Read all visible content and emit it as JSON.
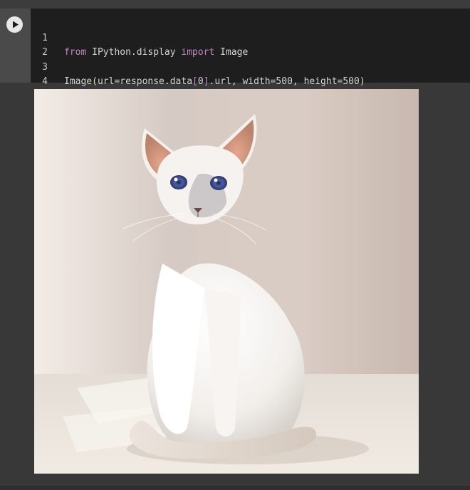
{
  "cell": {
    "run_icon": "play-icon",
    "lines": [
      {
        "num": "1",
        "kw1": "from",
        "mod": " IPython.display ",
        "kw2": "import",
        "name": " Image"
      },
      {
        "num": "2"
      },
      {
        "num": "3",
        "p1": "Image",
        "p2": "(",
        "p3": "url=response.data",
        "p4": "[",
        "p5": "0",
        "p6": "]",
        "p7": ".url, width=500, height=500",
        "p8": ")"
      },
      {
        "num": "4"
      }
    ]
  },
  "output": {
    "image_subject": "white siamese cat sitting on floor"
  },
  "colors": {
    "editor_bg": "#1e1e1e",
    "keyword": "#c586c0",
    "bracket": "#dcdcaa",
    "text": "#d4d4d4"
  }
}
